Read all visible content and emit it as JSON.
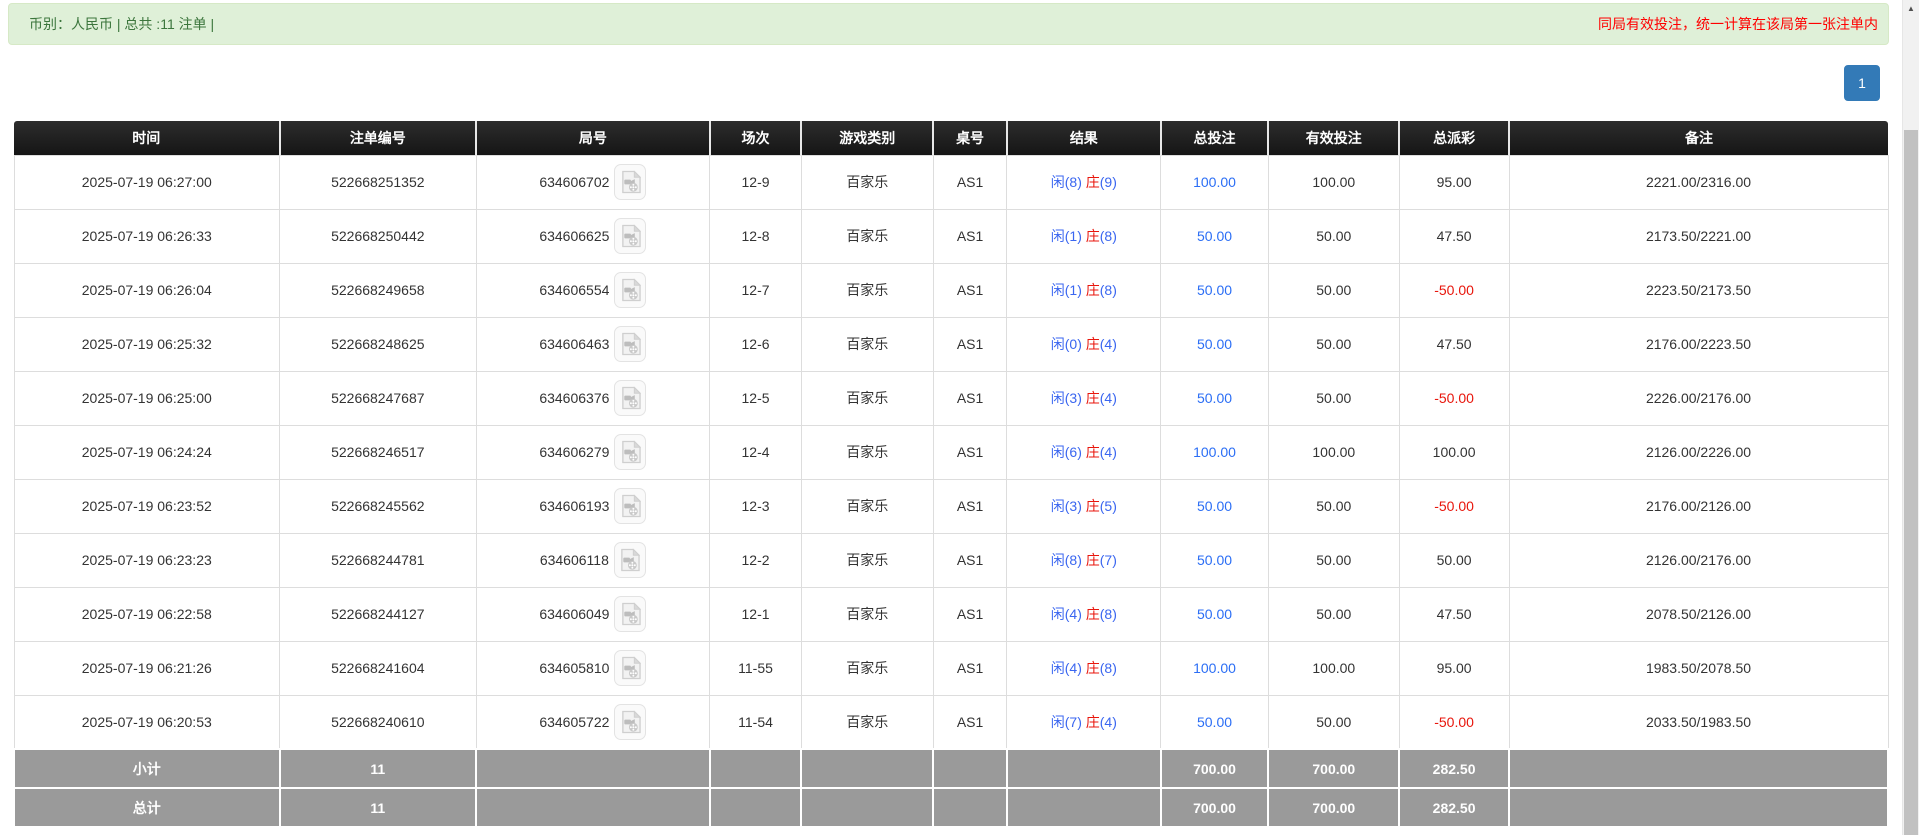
{
  "top_bar": {
    "summary": "币别：人民币 | 总共 :11 注单 |",
    "notice": "同局有效投注，统一计算在该局第一张注单内"
  },
  "pagination": {
    "current_page": "1"
  },
  "icons": {
    "video_icon": "video-file-icon",
    "scrollbar_up": "▲"
  },
  "colors": {
    "alert_bg": "#dff0d8",
    "alert_text": "#3c763d",
    "notice_red": "#ff0000",
    "header_bg": "#1d1d1d",
    "footer_bg": "#9a9a9a",
    "link_blue": "#2b6ef5",
    "result_blue": "#3a66f0",
    "result_red": "#e8160c",
    "page_btn_blue": "#337ab7"
  },
  "table": {
    "headers": [
      "时间",
      "注单编号",
      "局号",
      "场次",
      "游戏类别",
      "桌号",
      "结果",
      "总投注",
      "有效投注",
      "总派彩",
      "备注"
    ],
    "rows": [
      {
        "time": "2025-07-19 06:27:00",
        "bet_id": "522668251352",
        "round_id": "634606702",
        "session": "12-9",
        "game": "百家乐",
        "table_no": "AS1",
        "result_player": "闲(8)",
        "result_banker": "庄",
        "result_banker_score": "(9)",
        "total_bet": "100.00",
        "valid_bet": "100.00",
        "payout": "95.00",
        "remark": "2221.00/2316.00"
      },
      {
        "time": "2025-07-19 06:26:33",
        "bet_id": "522668250442",
        "round_id": "634606625",
        "session": "12-8",
        "game": "百家乐",
        "table_no": "AS1",
        "result_player": "闲(1)",
        "result_banker": "庄",
        "result_banker_score": "(8)",
        "total_bet": "50.00",
        "valid_bet": "50.00",
        "payout": "47.50",
        "remark": "2173.50/2221.00"
      },
      {
        "time": "2025-07-19 06:26:04",
        "bet_id": "522668249658",
        "round_id": "634606554",
        "session": "12-7",
        "game": "百家乐",
        "table_no": "AS1",
        "result_player": "闲(1)",
        "result_banker": "庄",
        "result_banker_score": "(8)",
        "total_bet": "50.00",
        "valid_bet": "50.00",
        "payout": "-50.00",
        "remark": "2223.50/2173.50"
      },
      {
        "time": "2025-07-19 06:25:32",
        "bet_id": "522668248625",
        "round_id": "634606463",
        "session": "12-6",
        "game": "百家乐",
        "table_no": "AS1",
        "result_player": "闲(0)",
        "result_banker": "庄",
        "result_banker_score": "(4)",
        "total_bet": "50.00",
        "valid_bet": "50.00",
        "payout": "47.50",
        "remark": "2176.00/2223.50"
      },
      {
        "time": "2025-07-19 06:25:00",
        "bet_id": "522668247687",
        "round_id": "634606376",
        "session": "12-5",
        "game": "百家乐",
        "table_no": "AS1",
        "result_player": "闲(3)",
        "result_banker": "庄",
        "result_banker_score": "(4)",
        "total_bet": "50.00",
        "valid_bet": "50.00",
        "payout": "-50.00",
        "remark": "2226.00/2176.00"
      },
      {
        "time": "2025-07-19 06:24:24",
        "bet_id": "522668246517",
        "round_id": "634606279",
        "session": "12-4",
        "game": "百家乐",
        "table_no": "AS1",
        "result_player": "闲(6)",
        "result_banker": "庄",
        "result_banker_score": "(4)",
        "total_bet": "100.00",
        "valid_bet": "100.00",
        "payout": "100.00",
        "remark": "2126.00/2226.00"
      },
      {
        "time": "2025-07-19 06:23:52",
        "bet_id": "522668245562",
        "round_id": "634606193",
        "session": "12-3",
        "game": "百家乐",
        "table_no": "AS1",
        "result_player": "闲(3)",
        "result_banker": "庄",
        "result_banker_score": "(5)",
        "total_bet": "50.00",
        "valid_bet": "50.00",
        "payout": "-50.00",
        "remark": "2176.00/2126.00"
      },
      {
        "time": "2025-07-19 06:23:23",
        "bet_id": "522668244781",
        "round_id": "634606118",
        "session": "12-2",
        "game": "百家乐",
        "table_no": "AS1",
        "result_player": "闲(8)",
        "result_banker": "庄",
        "result_banker_score": "(7)",
        "total_bet": "50.00",
        "valid_bet": "50.00",
        "payout": "50.00",
        "remark": "2126.00/2176.00"
      },
      {
        "time": "2025-07-19 06:22:58",
        "bet_id": "522668244127",
        "round_id": "634606049",
        "session": "12-1",
        "game": "百家乐",
        "table_no": "AS1",
        "result_player": "闲(4)",
        "result_banker": "庄",
        "result_banker_score": "(8)",
        "total_bet": "50.00",
        "valid_bet": "50.00",
        "payout": "47.50",
        "remark": "2078.50/2126.00"
      },
      {
        "time": "2025-07-19 06:21:26",
        "bet_id": "522668241604",
        "round_id": "634605810",
        "session": "11-55",
        "game": "百家乐",
        "table_no": "AS1",
        "result_player": "闲(4)",
        "result_banker": "庄",
        "result_banker_score": "(8)",
        "total_bet": "100.00",
        "valid_bet": "100.00",
        "payout": "95.00",
        "remark": "1983.50/2078.50"
      },
      {
        "time": "2025-07-19 06:20:53",
        "bet_id": "522668240610",
        "round_id": "634605722",
        "session": "11-54",
        "game": "百家乐",
        "table_no": "AS1",
        "result_player": "闲(7)",
        "result_banker": "庄",
        "result_banker_score": "(4)",
        "total_bet": "50.00",
        "valid_bet": "50.00",
        "payout": "-50.00",
        "remark": "2033.50/1983.50"
      }
    ],
    "footer": [
      {
        "label": "小计",
        "count": "11",
        "total_bet": "700.00",
        "valid_bet": "700.00",
        "payout": "282.50"
      },
      {
        "label": "总计",
        "count": "11",
        "total_bet": "700.00",
        "valid_bet": "700.00",
        "payout": "282.50"
      }
    ]
  }
}
